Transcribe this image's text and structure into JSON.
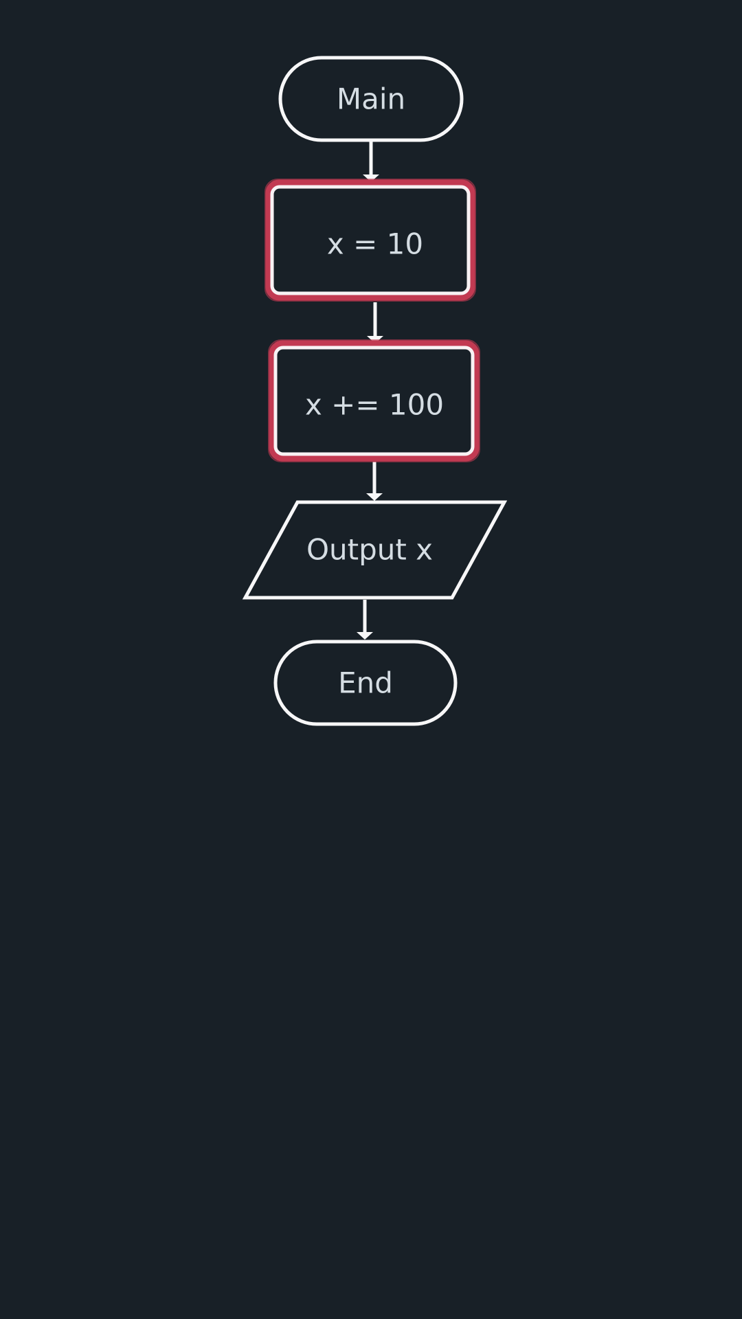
{
  "flowchart": {
    "nodes": [
      {
        "id": "main",
        "shape": "terminator",
        "label": "Main",
        "highlighted": false
      },
      {
        "id": "assign",
        "shape": "process",
        "label": "x = 10",
        "highlighted": true
      },
      {
        "id": "increment",
        "shape": "process",
        "label": "x += 100",
        "highlighted": true
      },
      {
        "id": "output",
        "shape": "io",
        "label": "Output x",
        "highlighted": false
      },
      {
        "id": "end",
        "shape": "terminator",
        "label": "End",
        "highlighted": false
      }
    ],
    "edges": [
      {
        "from": "main",
        "to": "assign"
      },
      {
        "from": "assign",
        "to": "increment"
      },
      {
        "from": "increment",
        "to": "output"
      },
      {
        "from": "output",
        "to": "end"
      }
    ]
  },
  "colors": {
    "background": "#182027",
    "outline": "#f7f7f8",
    "highlight": "#c23a52",
    "text": "#d5dde3"
  }
}
